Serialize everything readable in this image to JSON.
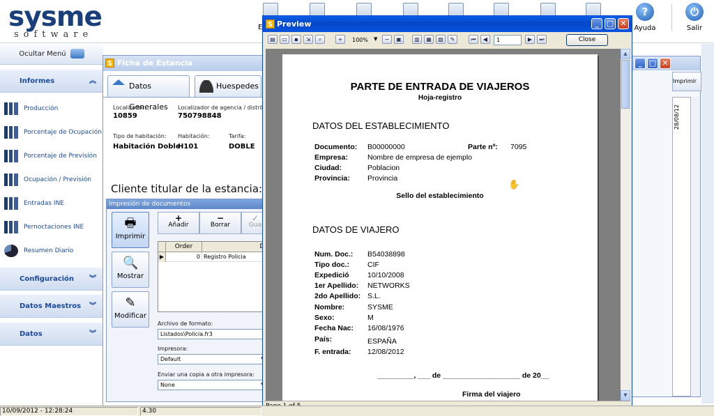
{
  "logo": {
    "main": "sysme",
    "sub": "software"
  },
  "toolbar": {
    "partial_label": "E",
    "help": "Ayuda",
    "exit": "Salir"
  },
  "menu": {
    "hide_label": "Ocultar Menú",
    "sections": [
      {
        "label": "Informes",
        "expanded": true
      },
      {
        "label": "Configuración",
        "expanded": false
      },
      {
        "label": "Datos Maestros",
        "expanded": false
      },
      {
        "label": "Datos",
        "expanded": false
      }
    ],
    "items": [
      "Producción",
      "Porcentaje de Ocupación",
      "Porcentaje de Previsión",
      "Ocupación / Previsión",
      "Entradas INE",
      "Pernoctaciones INE",
      "Resumen Diario"
    ]
  },
  "status": {
    "datetime": "10/09/2012 - 12:28:24",
    "version": "4.30"
  },
  "ficha": {
    "title": "Ficha de Estancia",
    "tabs": [
      "Datos Generales",
      "Huespedes"
    ],
    "localizador_label": "Localizador:",
    "localizador": "10859",
    "agencia_label": "Localizador de agencia / distribu",
    "agencia": "750798848",
    "tipo_label": "Tipo de habitación:",
    "tipo": "Habitación Doble",
    "hab_label": "Habitación:",
    "hab": "H101",
    "tarifa_label": "Tarifa:",
    "tarifa": "DOBLE",
    "cliente": "Cliente titular de la estancia:",
    "cut_text": "Do"
  },
  "impresion": {
    "title": "Impresión de documentos",
    "buttons": [
      "Imprimir",
      "Mostrar",
      "Modificar"
    ],
    "actions": {
      "add_label": "Añadir",
      "del_label": "Borrar",
      "save_label": "Gua"
    },
    "grid": {
      "headers": [
        "Order",
        "De"
      ],
      "row": {
        "order": "0",
        "desc": "Registro Policia"
      }
    },
    "archivo_label": "Archivo de formato:",
    "archivo_value": "Listados\\Policia.fr3",
    "impresora_label": "Impresora:",
    "impresora_value": "Default",
    "copia_label": "Enviar una copia a otra impresora:",
    "copia_value": "None"
  },
  "backwin": {
    "button": "Imprimir",
    "date": "28/08/12"
  },
  "preview": {
    "title": "Preview",
    "zoom": "100%",
    "page_input": "1",
    "close": "Close",
    "status": "Page 1 of 5"
  },
  "doc": {
    "title": "PARTE DE ENTRADA DE VIAJEROS",
    "subtitle": "Hoja-registro",
    "sec1": "DATOS DEL ESTABLECIMIENTO",
    "documento_label": "Documento:",
    "documento": "B00000000",
    "parte_label": "Parte nº:",
    "parte": "7095",
    "empresa_label": "Empresa:",
    "empresa": "Nombre de empresa de ejemplo",
    "ciudad_label": "Ciudad:",
    "ciudad": "Poblacion",
    "provincia_label": "Provincia:",
    "provincia": "Provincia",
    "sello": "Sello del establecimiento",
    "sec2": "DATOS DE VIAJERO",
    "traveler": [
      {
        "label": "Num. Doc.:",
        "value": "B54038898"
      },
      {
        "label": "Tipo doc.:",
        "value": "CIF"
      },
      {
        "label": "Expedició",
        "value": "10/10/2008"
      },
      {
        "label": "1er Apellido:",
        "value": "NETWORKS"
      },
      {
        "label": "2do Apellido:",
        "value": "S.L."
      },
      {
        "label": "Nombre:",
        "value": "SYSME"
      },
      {
        "label": "Sexo:",
        "value": "M"
      },
      {
        "label": "Fecha Nac:",
        "value": "16/08/1976"
      },
      {
        "label": "País:",
        "value": "ESPAÑA"
      },
      {
        "label": "F. entrada:",
        "value": "12/08/2012"
      }
    ],
    "date_line": "_________, ___ de ___________________ de 20__",
    "firma": "Firma del viajero"
  }
}
